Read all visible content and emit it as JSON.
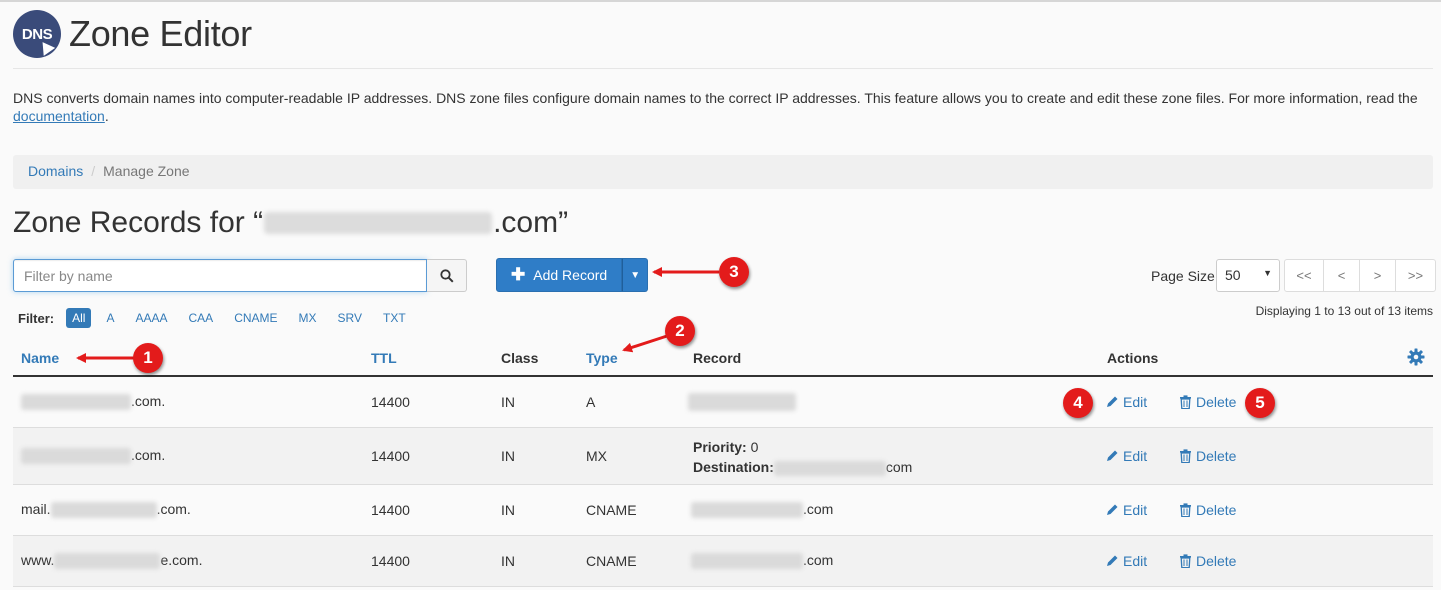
{
  "app": {
    "logo_text": "DNS",
    "title": "Zone Editor"
  },
  "description": {
    "text": "DNS converts domain names into computer-readable IP addresses. DNS zone files configure domain names to the correct IP addresses. This feature allows you to create and edit these zone files. For more information, read the ",
    "link_text": "documentation",
    "suffix": "."
  },
  "breadcrumb": {
    "items": [
      "Domains",
      "Manage Zone"
    ],
    "separator": "/"
  },
  "zone": {
    "prefix": "Zone Records for “",
    "suffix": ".com”"
  },
  "search": {
    "placeholder": "Filter by name"
  },
  "toolbar": {
    "add_record_label": "Add Record",
    "page_size_label": "Page Size",
    "page_size_value": "50",
    "pager": [
      "<<",
      "<",
      ">",
      ">>"
    ],
    "displaying": "Displaying 1 to 13 out of 13 items"
  },
  "filter": {
    "label": "Filter:",
    "options": [
      "All",
      "A",
      "AAAA",
      "CAA",
      "CNAME",
      "MX",
      "SRV",
      "TXT"
    ],
    "active": "All"
  },
  "table": {
    "headers": {
      "name": "Name",
      "ttl": "TTL",
      "class": "Class",
      "type": "Type",
      "record": "Record",
      "actions": "Actions"
    },
    "rows": [
      {
        "name_prefix": "",
        "name_suffix": ".com.",
        "ttl": "14400",
        "class": "IN",
        "type": "A",
        "record": "",
        "edit": "Edit",
        "delete": "Delete"
      },
      {
        "name_prefix": "",
        "name_suffix": ".com.",
        "ttl": "14400",
        "class": "IN",
        "type": "MX",
        "priority_label": "Priority:",
        "priority_value": "0",
        "destination_label": "Destination:",
        "destination_suffix": "com",
        "edit": "Edit",
        "delete": "Delete"
      },
      {
        "name_prefix": "mail.",
        "name_suffix": ".com.",
        "ttl": "14400",
        "class": "IN",
        "type": "CNAME",
        "record_suffix": ".com",
        "edit": "Edit",
        "delete": "Delete"
      },
      {
        "name_prefix": "www.",
        "name_suffix": "e.com.",
        "ttl": "14400",
        "class": "IN",
        "type": "CNAME",
        "record_suffix": ".com",
        "edit": "Edit",
        "delete": "Delete"
      }
    ]
  },
  "callouts": [
    "1",
    "2",
    "3",
    "4",
    "5"
  ],
  "colors": {
    "primary": "#337ab7",
    "button": "#2f7dc7",
    "callout": "#e31b1b",
    "logo_bg": "#3a4b7a"
  }
}
